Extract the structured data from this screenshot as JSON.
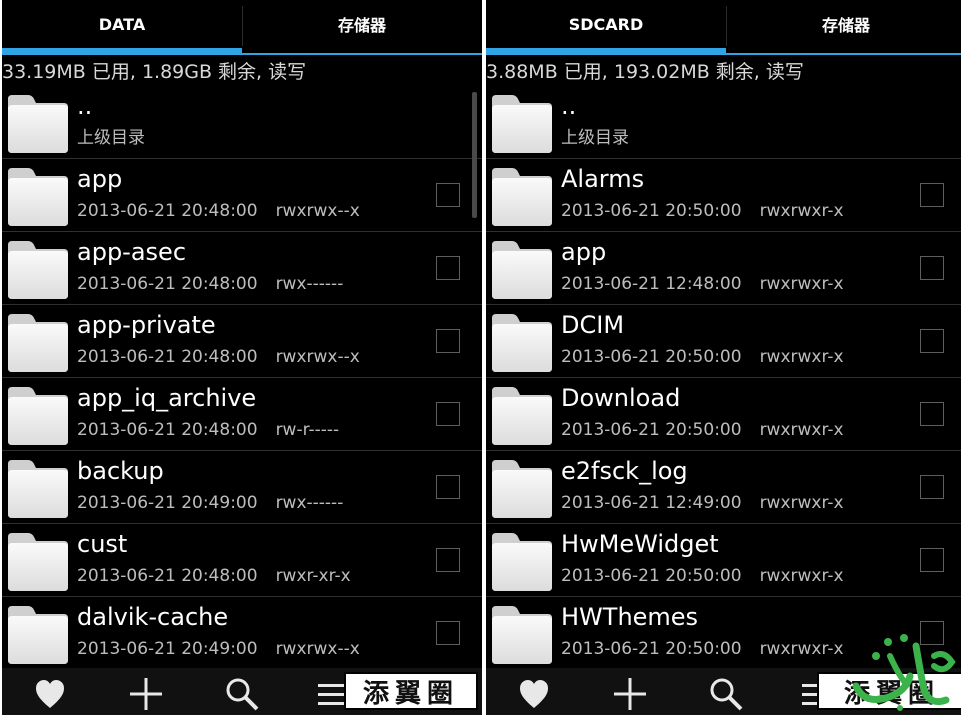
{
  "colors": {
    "accent": "#30a5e6",
    "background": "#000000",
    "logo_green": "#3bb34a"
  },
  "left": {
    "tabs": [
      {
        "label": "DATA"
      },
      {
        "label": "存储器"
      }
    ],
    "summary": "33.19MB 已用, 1.89GB 剩余, 读写",
    "parent": {
      "name": "..",
      "label": "上级目录"
    },
    "items": [
      {
        "name": "app",
        "date": "2013-06-21 20:48:00",
        "perm": "rwxrwx--x"
      },
      {
        "name": "app-asec",
        "date": "2013-06-21 20:48:00",
        "perm": "rwx------"
      },
      {
        "name": "app-private",
        "date": "2013-06-21 20:48:00",
        "perm": "rwxrwx--x"
      },
      {
        "name": "app_iq_archive",
        "date": "2013-06-21 20:48:00",
        "perm": "rw-r-----"
      },
      {
        "name": "backup",
        "date": "2013-06-21 20:49:00",
        "perm": "rwx------"
      },
      {
        "name": "cust",
        "date": "2013-06-21 20:48:00",
        "perm": "rwxr-xr-x"
      },
      {
        "name": "dalvik-cache",
        "date": "2013-06-21 20:49:00",
        "perm": "rwxrwx--x"
      }
    ],
    "stamp": "添翼圈"
  },
  "right": {
    "tabs": [
      {
        "label": "SDCARD"
      },
      {
        "label": "存储器"
      }
    ],
    "summary": "3.88MB 已用, 193.02MB 剩余, 读写",
    "parent": {
      "name": "..",
      "label": "上级目录"
    },
    "items": [
      {
        "name": "Alarms",
        "date": "2013-06-21 20:50:00",
        "perm": "rwxrwxr-x"
      },
      {
        "name": "app",
        "date": "2013-06-21 12:48:00",
        "perm": "rwxrwxr-x"
      },
      {
        "name": "DCIM",
        "date": "2013-06-21 20:50:00",
        "perm": "rwxrwxr-x"
      },
      {
        "name": "Download",
        "date": "2013-06-21 20:50:00",
        "perm": "rwxrwxr-x"
      },
      {
        "name": "e2fsck_log",
        "date": "2013-06-21 12:49:00",
        "perm": "rwxrwxr-x"
      },
      {
        "name": "HwMeWidget",
        "date": "2013-06-21 20:50:00",
        "perm": "rwxrwxr-x"
      },
      {
        "name": "HWThemes",
        "date": "2013-06-21 20:50:00",
        "perm": "rwxrwxr-x"
      }
    ],
    "stamp": "添翼圈"
  },
  "icons": {
    "folder": "folder-icon",
    "favorite": "heart-icon",
    "add": "plus-icon",
    "search": "search-icon",
    "menu": "menu-icon",
    "close": "close-icon"
  }
}
